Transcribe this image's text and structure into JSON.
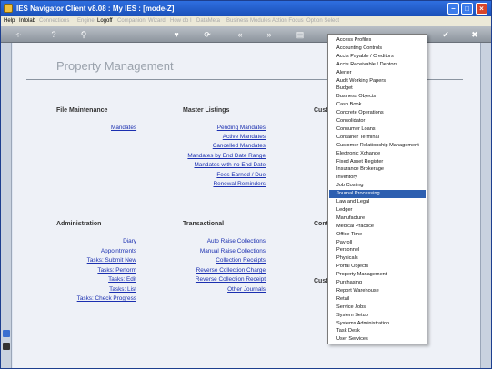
{
  "window": {
    "title": "IES Navigator Client v8.08 : My IES :     [mode-Z]"
  },
  "menubar": {
    "items": [
      {
        "label": "Help",
        "enabled": true
      },
      {
        "label": "Infolab",
        "enabled": true
      },
      {
        "label": "Connections",
        "enabled": false
      },
      {
        "label": "Engine",
        "enabled": false
      },
      {
        "label": "Logoff",
        "enabled": true
      },
      {
        "label": "Companion",
        "enabled": false
      },
      {
        "label": "Wizard",
        "enabled": false
      },
      {
        "label": "How do I",
        "enabled": false
      },
      {
        "label": "DataMeta",
        "enabled": false
      },
      {
        "label": "Business Modules",
        "enabled": false
      },
      {
        "label": "Action Focus",
        "enabled": false
      },
      {
        "label": "Option Select",
        "enabled": false
      }
    ]
  },
  "page": {
    "title": "Property Management"
  },
  "sections": {
    "file_maintenance": {
      "heading": "File Maintenance",
      "links": [
        "Mandates"
      ]
    },
    "master_listings": {
      "heading": "Master Listings",
      "links": [
        "Pending Mandates",
        "Active Mandates",
        "Cancelled Mandates",
        "Mandates by End Date Range",
        "Mandates with no End Date",
        "Fees Earned / Due",
        "Renewal Reminders"
      ]
    },
    "cust_top": {
      "heading": "Cust"
    },
    "administration": {
      "heading": "Administration",
      "links": [
        "Diary",
        "Appointments",
        "Tasks: Submit New",
        "Tasks: Perform",
        "Tasks: Edit",
        "Tasks: List",
        "Tasks: Check Progress"
      ]
    },
    "transactional": {
      "heading": "Transactional",
      "links": [
        "Auto Raise Collections",
        "Manual Raise Collections",
        "Collection Receipts",
        "Reverse Collection Charge",
        "Reverse Collection Receipt",
        "Other Journals"
      ]
    },
    "cont": {
      "heading": "Cont"
    },
    "cust_bottom": {
      "heading": "Cust"
    }
  },
  "dropdown": {
    "selected_index": 20,
    "items": [
      "Access Profiles",
      "Accounting Controls",
      "Accts Payable / Creditors",
      "Accts Receivable / Debtors",
      "Alerter",
      "Audit Working Papers",
      "Budget",
      "Business Objects",
      "Cash Book",
      "Concrete Operations",
      "Consolidator",
      "Consumer Loans",
      "Container Terminal",
      "Customer Relationship Management",
      "Electronic Xchange",
      "Fixed Asset Register",
      "Insurance Brokerage",
      "Inventory",
      "Job Costing",
      "Journal Processing",
      "Law and Legal",
      "Ledger",
      "Manufacture",
      "Medical Practice",
      "Office Time",
      "Payroll",
      "Personnel",
      "Physicals",
      "Portal Objects",
      "Property Management",
      "Purchasing",
      "Report Warehouse",
      "Retail",
      "Service Jobs",
      "System Setup",
      "Systems Administration",
      "Task Desk",
      "User Services"
    ]
  },
  "colors": {
    "titlebar": "#1a4fb8",
    "link": "#1a2fb0",
    "selection": "#2d5fb0"
  }
}
